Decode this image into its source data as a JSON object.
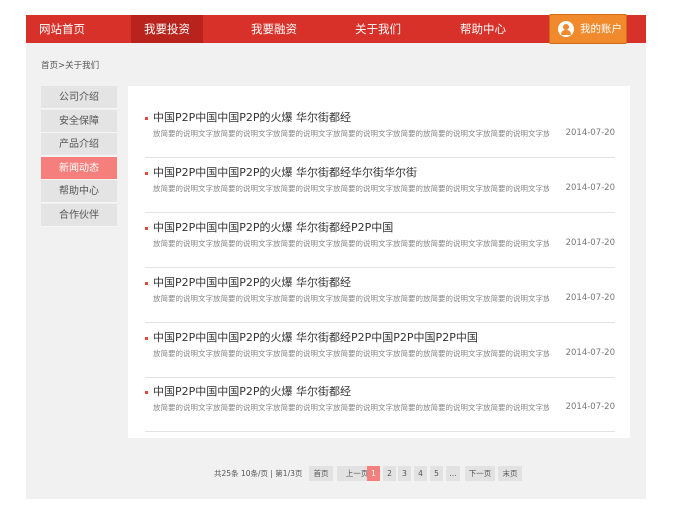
{
  "nav": {
    "items": [
      {
        "label": "网站首页"
      },
      {
        "label": "我要投资"
      },
      {
        "label": "我要融资"
      },
      {
        "label": "关于我们"
      },
      {
        "label": "帮助中心"
      }
    ],
    "account_label": "我的账户"
  },
  "breadcrumb": "首页>关于我们",
  "sidebar": {
    "items": [
      {
        "label": "公司介绍"
      },
      {
        "label": "安全保障"
      },
      {
        "label": "产品介绍"
      },
      {
        "label": "新闻动态"
      },
      {
        "label": "帮助中心"
      },
      {
        "label": "合作伙伴"
      }
    ],
    "active_index": 3
  },
  "articles": [
    {
      "title": "中国P2P中国中国P2P的火爆 华尔街都经",
      "summary": "放简要的说明文字放简要的说明文字放简要的说明文字放简要的说明文字放简要的放简要的说明文字放简要的说明文字放简要的...",
      "date": "2014-07-20"
    },
    {
      "title": "中国P2P中国中国P2P的火爆 华尔街都经华尔街华尔街",
      "summary": "放简要的说明文字放简要的说明文字放简要的说明文字放简要的说明文字放简要的放简要的说明文字放简要的说明文字放简要的...",
      "date": "2014-07-20"
    },
    {
      "title": "中国P2P中国中国P2P的火爆 华尔街都经P2P中国",
      "summary": "放简要的说明文字放简要的说明文字放简要的说明文字放简要的说明文字放简要的放简要的说明文字放简要的说明文字放简要的...",
      "date": "2014-07-20"
    },
    {
      "title": "中国P2P中国中国P2P的火爆 华尔街都经",
      "summary": "放简要的说明文字放简要的说明文字放简要的说明文字放简要的说明文字放简要的放简要的说明文字放简要的说明文字放简要的...",
      "date": "2014-07-20"
    },
    {
      "title": "中国P2P中国中国P2P的火爆 华尔街都经P2P中国P2P中国P2P中国",
      "summary": "放简要的说明文字放简要的说明文字放简要的说明文字放简要的说明文字放简要的放简要的说明文字放简要的说明文字放简要的...",
      "date": "2014-07-20"
    },
    {
      "title": "中国P2P中国中国P2P的火爆 华尔街都经",
      "summary": "放简要的说明文字放简要的说明文字放简要的说明文字放简要的说明文字放简要的放简要的说明文字放简要的说明文字放简要的...",
      "date": "2014-07-20"
    }
  ],
  "pagination": {
    "summary": "共25条 10条/页 | 第1/3页",
    "first": "首页",
    "prev": "上一页",
    "pages": [
      "1",
      "2",
      "3",
      "4",
      "5",
      "..."
    ],
    "current_page": "1",
    "next": "下一页",
    "last": "末页"
  },
  "colors": {
    "nav_bg": "#d8312a",
    "nav_active": "#b8231d",
    "account_btn": "#f08a2c",
    "sidebar_active": "#f47f7c",
    "page_current": "#f47f7c"
  },
  "icons": {
    "account": "user-icon"
  }
}
